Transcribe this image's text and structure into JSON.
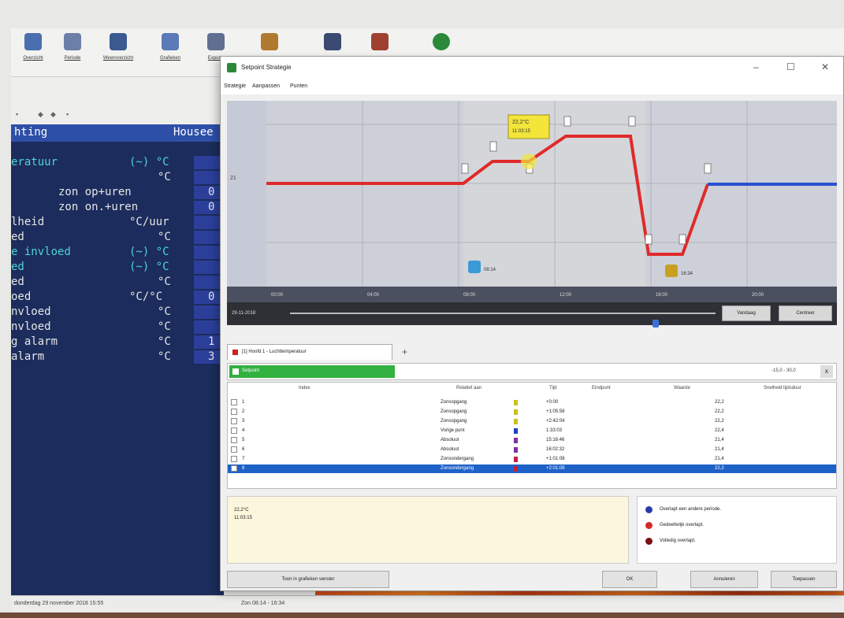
{
  "background_app": {
    "toolbar": [
      {
        "label": "Overzicht",
        "icon": "document-icon",
        "color": "#4a6fb0"
      },
      {
        "label": "Periode",
        "icon": "calendar-icon",
        "color": "#6b7fa8"
      },
      {
        "label": "Weeroverzicht",
        "icon": "weather-icon",
        "color": "#3a5a90"
      },
      {
        "label": "Grafieken",
        "icon": "graph-icon",
        "color": "#5a7ab8"
      },
      {
        "label": "Exportx",
        "icon": "export-icon",
        "color": "#607090"
      }
    ],
    "extra_icons": [
      {
        "icon": "box-icon",
        "color": "#b07a30"
      },
      {
        "icon": "monitor-icon",
        "color": "#3a4a70"
      },
      {
        "icon": "figure-icon",
        "color": "#a04030"
      },
      {
        "icon": "globe-icon",
        "color": "#2a8a3a"
      }
    ],
    "terminal": {
      "header_left": "hting",
      "header_right": "Housee",
      "rows": [
        {
          "left": "eratuur",
          "mid": "(~) °C",
          "val": "",
          "cyan": true
        },
        {
          "left": "",
          "mid": "°C",
          "val": "",
          "cyan": false
        },
        {
          "left": "zon op+uren",
          "mid": "",
          "val": "0",
          "cyan": false
        },
        {
          "left": "zon on.+uren",
          "mid": "",
          "val": "0",
          "cyan": false
        },
        {
          "left": "lheid",
          "mid": "°C/uur",
          "val": "",
          "cyan": false
        },
        {
          "left": "ed",
          "mid": "°C",
          "val": "",
          "cyan": false
        },
        {
          "left": "e invloed",
          "mid": "(~) °C",
          "val": "",
          "cyan": true
        },
        {
          "left": "ed",
          "mid": "(~) °C",
          "val": "",
          "cyan": true
        },
        {
          "left": "ed",
          "mid": "°C",
          "val": "",
          "cyan": false
        },
        {
          "left": "oed",
          "mid": "°C/°C",
          "val": "0",
          "cyan": false
        },
        {
          "left": "nvloed",
          "mid": "°C",
          "val": "",
          "cyan": false
        },
        {
          "left": "nvloed",
          "mid": "°C",
          "val": "",
          "cyan": false
        },
        {
          "left": "g alarm",
          "mid": "°C",
          "val": "1",
          "cyan": false
        },
        {
          "left": "alarm",
          "mid": "°C",
          "val": "3",
          "cyan": false
        }
      ]
    },
    "status_left": "donderdag 29 november 2018 15:55",
    "status_mid": "Zon 08:14 - 16:34"
  },
  "dialog": {
    "title": "Setpoint Strategie",
    "menu": [
      "Strategie",
      "Aanpassen",
      "Punten"
    ],
    "window_buttons": [
      "–",
      "☐",
      "✕"
    ],
    "chart": {
      "tooltip_line1": "22,2°C",
      "tooltip_line2": "11:03:15",
      "y_label": "21",
      "sunrise_label": "08:14",
      "sunset_label": "16:34",
      "time_labels": [
        "00:00",
        "04:00",
        "08:00",
        "12:00",
        "16:00",
        "20:00"
      ],
      "date_label": "29-11-2018",
      "slider_position": 0.86,
      "btn_left": "Vandaag",
      "btn_right": "Centreer"
    },
    "tab_label": "[1] Hoofd 1 - Luchttemperatuur",
    "tab_add": "+",
    "green_label": "Setpoint",
    "range_label": "-15,0 - 30,0",
    "range_close": "x",
    "table": {
      "headers": [
        "Index",
        "Relatief aan",
        "Tijd",
        "Eindpunt",
        "Waarde",
        "Snelheid tijdsduur"
      ],
      "rows": [
        {
          "index": "1",
          "relative": "Zonsopgang",
          "time": "+0:00",
          "value": "22,2",
          "marker": "#c8c020",
          "selected": false
        },
        {
          "index": "2",
          "relative": "Zonsopgang",
          "time": "+1:05:58",
          "value": "22,2",
          "marker": "#c8c020",
          "selected": false
        },
        {
          "index": "3",
          "relative": "Zonsopgang",
          "time": "+2:42:04",
          "value": "22,2",
          "marker": "#c8c020",
          "selected": false
        },
        {
          "index": "4",
          "relative": "Vorige punt",
          "time": "1:33:03",
          "value": "22,4",
          "marker": "#2040c0",
          "selected": false
        },
        {
          "index": "5",
          "relative": "Absoluut",
          "time": "15:16:46",
          "value": "21,4",
          "marker": "#8030a0",
          "selected": false
        },
        {
          "index": "6",
          "relative": "Absoluut",
          "time": "16:02:32",
          "value": "21,4",
          "marker": "#8030a0",
          "selected": false
        },
        {
          "index": "7",
          "relative": "Zonsondergang",
          "time": "+1:01:08",
          "value": "21,4",
          "marker": "#c02040",
          "selected": false
        },
        {
          "index": "8",
          "relative": "Zonsondergang",
          "time": "+2:01:08",
          "value": "22,2",
          "marker": "#c02040",
          "selected": true
        }
      ]
    },
    "info_line1": "22,2°C",
    "info_line2": "11:03:15",
    "legend": [
      {
        "label": "Overlapt een andere periode.",
        "color": "#2a3aa8"
      },
      {
        "label": "Gedeeltelijk overlapt.",
        "color": "#d62828"
      },
      {
        "label": "Volledig overlapt.",
        "color": "#7a1010"
      }
    ],
    "buttons": {
      "show_graph": "Toon in grafieken venster",
      "ok": "OK",
      "cancel": "Annuleren",
      "apply": "Toepassen"
    }
  },
  "colors": {
    "line_red": "#e02a2a",
    "line_blue": "#2a4fd0",
    "terminal_bg": "#1c2c5c",
    "selection": "#1e62c8"
  }
}
